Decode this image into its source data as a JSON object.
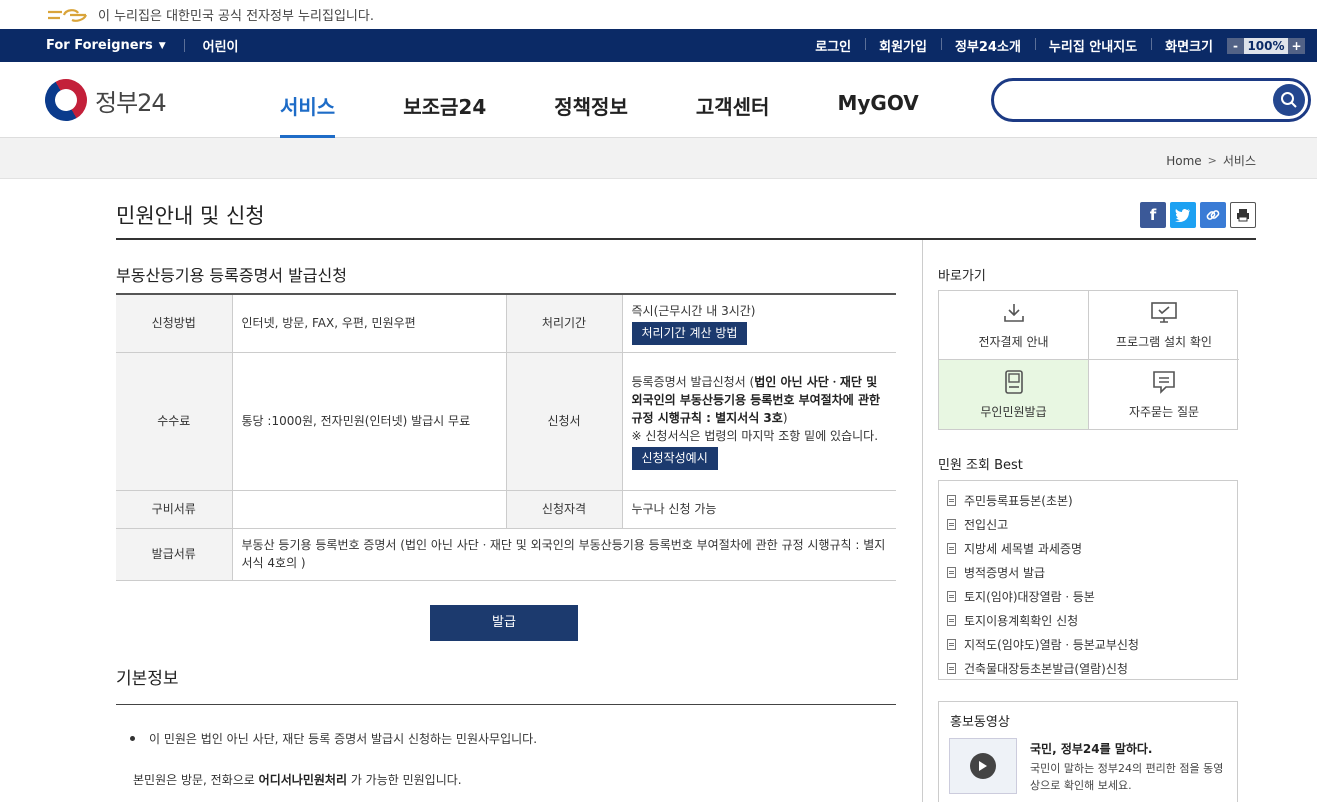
{
  "top_notice": "이 누리집은 대한민국 공식 전자정부 누리집입니다.",
  "navbar": {
    "foreigners": "For Foreigners",
    "kids": "어린이",
    "right_items": [
      "로그인",
      "회원가입",
      "정부24소개",
      "누리집 안내지도",
      "화면크기"
    ],
    "zoom_minus": "-",
    "zoom_value": "100%",
    "zoom_plus": "+"
  },
  "logo_text": "정부24",
  "gnb": [
    "서비스",
    "보조금24",
    "정책정보",
    "고객센터",
    "MyGOV"
  ],
  "search": {
    "placeholder": ""
  },
  "breadcrumb": {
    "home": "Home",
    "current": "서비스"
  },
  "page_title": "민원안내 및 신청",
  "service_title": "부동산등기용 등록증명서 발급신청",
  "table": {
    "method_label": "신청방법",
    "method_value": "인터넷, 방문, FAX, 우편, 민원우편",
    "period_label": "처리기간",
    "period_value": "즉시(근무시간 내 3시간)",
    "period_button": "처리기간 계산 방법",
    "fee_label": "수수료",
    "fee_value": "통당 :1000원, 전자민원(인터넷) 발급시 무료",
    "form_label": "신청서",
    "form_value_prefix": "등록증명서 발급신청서 (",
    "form_value_bold": "법인 아닌 사단ㆍ재단 및 외국인의 부동산등기용 등록번호 부여절차에 관한 규정 시행규칙 : 별지서식 3호",
    "form_value_suffix": ")",
    "form_note": "※ 신청서식은 법령의 마지막 조항 밑에 있습니다.",
    "form_button": "신청작성예시",
    "docs_label": "구비서류",
    "docs_value": "",
    "qual_label": "신청자격",
    "qual_value": "누구나 신청 가능",
    "issue_label": "발급서류",
    "issue_value": "부동산 등기용 등록번호 증명서 (법인 아닌 사단ㆍ재단 및 외국인의 부동산등기용 등록번호 부여절차에 관한 규정 시행규칙 : 별지서식 4호의 )"
  },
  "issue_button": "발급",
  "basic_info": {
    "title": "기본정보",
    "bullet": "이 민원은 법인 아닌 사단, 재단 등록 증명서 발급시 신청하는 민원사무입니다.",
    "note_prefix": "본민원은 방문, 전화으로 ",
    "note_bold": "어디서나민원처리",
    "note_suffix": " 가 가능한 민원입니다."
  },
  "sidebar": {
    "quick_title": "바로가기",
    "quick": [
      "전자결제 안내",
      "프로그램 설치 확인",
      "무인민원발급",
      "자주묻는 질문"
    ],
    "best_title": "민원 조회 Best",
    "best": [
      "주민등록표등본(초본)",
      "전입신고",
      "지방세 세목별 과세증명",
      "병적증명서 발급",
      "토지(임야)대장열람ㆍ등본",
      "토지이용계획확인 신청",
      "지적도(임야도)열람ㆍ등본교부신청",
      "건축물대장등초본발급(열람)신청"
    ],
    "video_title": "홍보동영상",
    "video_heading": "국민, 정부24를 말하다.",
    "video_desc": "국민이 말하는 정부24의 편리한 점을 동영상으로 확인해 보세요."
  },
  "colors": {
    "nav_bg": "#0b2a66",
    "accent": "#1e6cc7",
    "button_bg": "#1c3a6e",
    "highlight": "#e8f7e2"
  }
}
